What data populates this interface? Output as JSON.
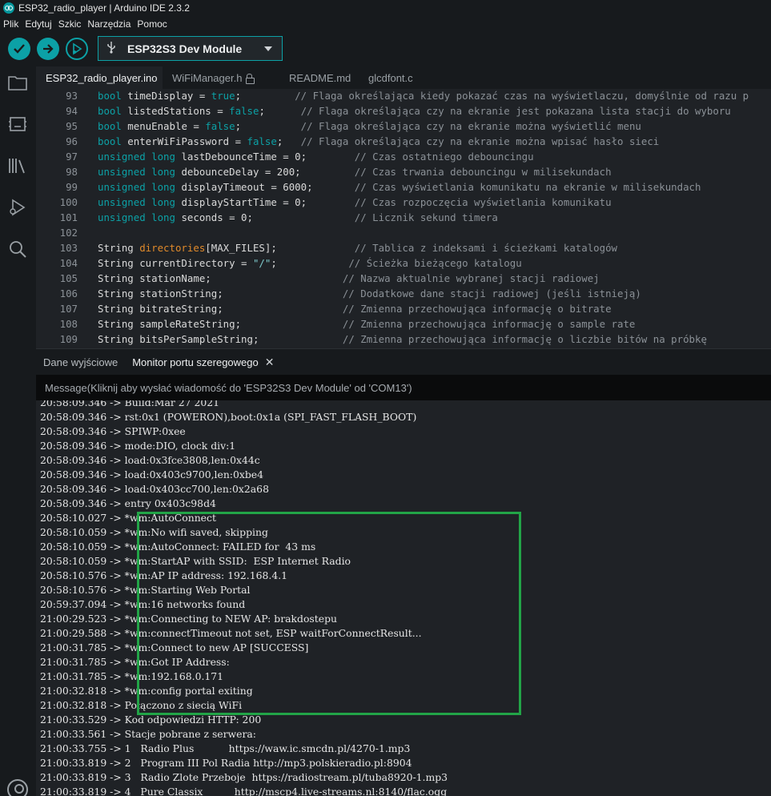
{
  "window": {
    "title": "ESP32_radio_player | Arduino IDE 2.3.2"
  },
  "menu": [
    "Plik",
    "Edytuj",
    "Szkic",
    "Narzędzia",
    "Pomoc"
  ],
  "toolbar": {
    "verify_icon": "check-icon",
    "upload_icon": "arrow-right-icon",
    "debug_icon": "debug-icon",
    "board": "ESP32S3 Dev Module"
  },
  "tabs": [
    {
      "label": "ESP32_radio_player.ino",
      "active": true
    },
    {
      "label": "WiFiManager.h",
      "locked": true
    },
    {
      "label": "README.md"
    },
    {
      "label": "glcdfont.c"
    }
  ],
  "colors": {
    "accent": "#0ca1a6",
    "highlight": "#22a447",
    "define": "#e08a2b"
  },
  "code": [
    {
      "n": "93",
      "parts": [
        [
          "kw",
          "bool"
        ],
        [
          "var",
          " timeDisplay = "
        ],
        [
          "kw",
          "true"
        ],
        [
          "var",
          ";"
        ],
        [
          "cm",
          "         // Flaga określająca kiedy pokazać czas na wyświetlaczu, domyślnie od razu p"
        ]
      ]
    },
    {
      "n": "94",
      "parts": [
        [
          "kw",
          "bool"
        ],
        [
          "var",
          " listedStations = "
        ],
        [
          "kw",
          "false"
        ],
        [
          "var",
          ";"
        ],
        [
          "cm",
          "      // Flaga określająca czy na ekranie jest pokazana lista stacji do wyboru"
        ]
      ]
    },
    {
      "n": "95",
      "parts": [
        [
          "kw",
          "bool"
        ],
        [
          "var",
          " menuEnable = "
        ],
        [
          "kw",
          "false"
        ],
        [
          "var",
          ";"
        ],
        [
          "cm",
          "          // Flaga określająca czy na ekranie można wyświetlić menu"
        ]
      ]
    },
    {
      "n": "96",
      "parts": [
        [
          "kw",
          "bool"
        ],
        [
          "var",
          " enterWiFiPassword = "
        ],
        [
          "kw",
          "false"
        ],
        [
          "var",
          ";"
        ],
        [
          "cm",
          "   // Flaga określająca czy na ekranie można wpisać hasło sieci"
        ]
      ]
    },
    {
      "n": "97",
      "parts": [
        [
          "kw",
          "unsigned long"
        ],
        [
          "var",
          " lastDebounceTime = 0;"
        ],
        [
          "cm",
          "        // Czas ostatniego debouncingu"
        ]
      ]
    },
    {
      "n": "98",
      "parts": [
        [
          "kw",
          "unsigned long"
        ],
        [
          "var",
          " debounceDelay = 200;"
        ],
        [
          "cm",
          "         // Czas trwania debouncingu w milisekundach"
        ]
      ]
    },
    {
      "n": "99",
      "parts": [
        [
          "kw",
          "unsigned long"
        ],
        [
          "var",
          " displayTimeout = 6000;"
        ],
        [
          "cm",
          "       // Czas wyświetlania komunikatu na ekranie w milisekundach"
        ]
      ]
    },
    {
      "n": "100",
      "parts": [
        [
          "kw",
          "unsigned long"
        ],
        [
          "var",
          " displayStartTime = 0;"
        ],
        [
          "cm",
          "        // Czas rozpoczęcia wyświetlania komunikatu"
        ]
      ]
    },
    {
      "n": "101",
      "parts": [
        [
          "kw",
          "unsigned long"
        ],
        [
          "var",
          " seconds = 0;"
        ],
        [
          "cm",
          "                 // Licznik sekund timera"
        ]
      ]
    },
    {
      "n": "102",
      "parts": []
    },
    {
      "n": "103",
      "parts": [
        [
          "var",
          "String "
        ],
        [
          "def",
          "directories"
        ],
        [
          "var",
          "[MAX_FILES];"
        ],
        [
          "cm",
          "             // Tablica z indeksami i ścieżkami katalogów"
        ]
      ]
    },
    {
      "n": "104",
      "parts": [
        [
          "var",
          "String currentDirectory = "
        ],
        [
          "str",
          "\"/\""
        ],
        [
          "var",
          ";"
        ],
        [
          "cm",
          "            // Ścieżka bieżącego katalogu"
        ]
      ]
    },
    {
      "n": "105",
      "parts": [
        [
          "var",
          "String stationName;"
        ],
        [
          "cm",
          "                      // Nazwa aktualnie wybranej stacji radiowej"
        ]
      ]
    },
    {
      "n": "106",
      "parts": [
        [
          "var",
          "String stationString;"
        ],
        [
          "cm",
          "                    // Dodatkowe dane stacji radiowej (jeśli istnieją)"
        ]
      ]
    },
    {
      "n": "107",
      "parts": [
        [
          "var",
          "String bitrateString;"
        ],
        [
          "cm",
          "                    // Zmienna przechowująca informację o bitrate"
        ]
      ]
    },
    {
      "n": "108",
      "parts": [
        [
          "var",
          "String sampleRateString;"
        ],
        [
          "cm",
          "                 // Zmienna przechowująca informację o sample rate"
        ]
      ]
    },
    {
      "n": "109",
      "parts": [
        [
          "var",
          "String bitsPerSampleString;"
        ],
        [
          "cm",
          "              // Zmienna przechowująca informację o liczbie bitów na próbkę"
        ]
      ]
    }
  ],
  "panel": {
    "tab_output": "Dane wyjściowe",
    "tab_serial": "Monitor portu szeregowego",
    "message_placeholder": "Message(Kliknij aby wysłać wiadomość do 'ESP32S3 Dev Module' od 'COM13')"
  },
  "serial": [
    "20:58:09.346 -> Build:Mar 27 2021",
    "20:58:09.346 -> rst:0x1 (POWERON),boot:0x1a (SPI_FAST_FLASH_BOOT)",
    "20:58:09.346 -> SPIWP:0xee",
    "20:58:09.346 -> mode:DIO, clock div:1",
    "20:58:09.346 -> load:0x3fce3808,len:0x44c",
    "20:58:09.346 -> load:0x403c9700,len:0xbe4",
    "20:58:09.346 -> load:0x403cc700,len:0x2a68",
    "20:58:09.346 -> entry 0x403c98d4",
    "20:58:10.027 -> *wm:AutoConnect",
    "20:58:10.059 -> *wm:No wifi saved, skipping",
    "20:58:10.059 -> *wm:AutoConnect: FAILED for  43 ms",
    "20:58:10.059 -> *wm:StartAP with SSID:  ESP Internet Radio",
    "20:58:10.576 -> *wm:AP IP address: 192.168.4.1",
    "20:58:10.576 -> *wm:Starting Web Portal",
    "20:59:37.094 -> *wm:16 networks found",
    "21:00:29.523 -> *wm:Connecting to NEW AP: brakdostepu",
    "21:00:29.588 -> *wm:connectTimeout not set, ESP waitForConnectResult...",
    "21:00:31.785 -> *wm:Connect to new AP [SUCCESS]",
    "21:00:31.785 -> *wm:Got IP Address:",
    "21:00:31.785 -> *wm:192.168.0.171",
    "21:00:32.818 -> *wm:config portal exiting",
    "21:00:32.818 -> Połączono z siecią WiFi",
    "21:00:33.529 -> Kod odpowiedzi HTTP: 200",
    "21:00:33.561 -> Stacje pobrane z serwera:",
    "21:00:33.755 -> 1   Radio Plus           https://waw.ic.smcdn.pl/4270-1.mp3",
    "21:00:33.819 -> 2   Program III Pol Radia http://mp3.polskieradio.pl:8904",
    "21:00:33.819 -> 3   Radio Zlote Przeboje  https://radiostream.pl/tuba8920-1.mp3",
    "21:00:33.819 -> 4   Pure Classix          http://mscp4.live-streams.nl:8140/flac.ogg"
  ]
}
